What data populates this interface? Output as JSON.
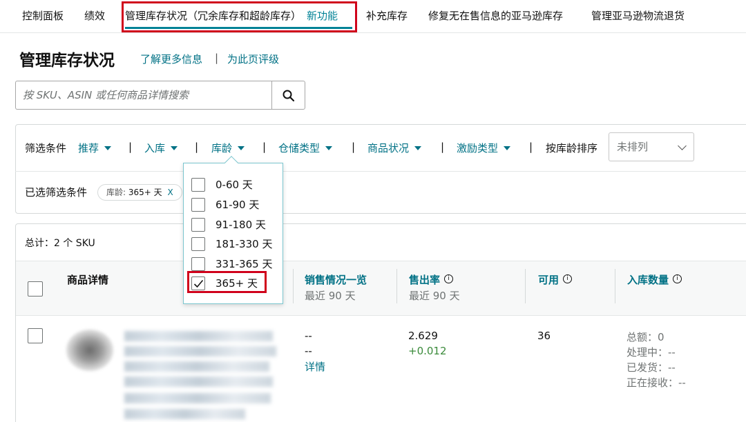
{
  "topnav": {
    "tabs": [
      "控制面板",
      "绩效",
      "管理库存状况（冗余库存和超龄库存）",
      "新功能",
      "补充库存",
      "修复无在售信息的亚马逊库存",
      "管理亚马逊物流退货"
    ]
  },
  "header": {
    "title": "管理库存状况",
    "learn_more": "了解更多信息",
    "separator": "|",
    "rate_page": "为此页评级"
  },
  "search": {
    "placeholder": "按 SKU、ASIN 或任何商品详情搜索"
  },
  "filters": {
    "label": "筛选条件",
    "items": [
      "推荐",
      "入库",
      "库龄",
      "仓储类型",
      "商品状况",
      "激励类型"
    ],
    "sort_label": "按库龄排序",
    "sort_value": "未排列",
    "selected_label": "已选筛选条件",
    "chip_key": "库龄:",
    "chip_value": "365+ 天",
    "chip_remove": "X"
  },
  "age_dropdown": {
    "options": [
      {
        "label": "0-60 天",
        "checked": false
      },
      {
        "label": "61-90 天",
        "checked": false
      },
      {
        "label": "91-180 天",
        "checked": false
      },
      {
        "label": "181-330 天",
        "checked": false
      },
      {
        "label": "331-365 天",
        "checked": false
      },
      {
        "label": "365+ 天",
        "checked": true
      }
    ]
  },
  "table": {
    "total": "总计：2 个 SKU",
    "columns": {
      "product": "商品详情",
      "sales": "销售情况一览",
      "sales_sub": "最近 90 天",
      "sell_through": "售出率",
      "sell_through_sub": "最近 90 天",
      "available": "可用",
      "inbound": "入库数量"
    },
    "rows": [
      {
        "sales_1": "--",
        "sales_2": "--",
        "details_link": "详情",
        "sell_through": "2.629",
        "sell_through_delta": "+0.012",
        "available": "36",
        "inbound_total": "总额：0",
        "inbound_processing": "处理中：--",
        "inbound_shipped": "已发货：--",
        "inbound_receiving": "正在接收：--"
      }
    ]
  },
  "colors": {
    "link": "#007185",
    "accent_teal": "#008296",
    "highlight_red": "#d0021b",
    "positive": "#3a8a3a"
  },
  "icons": {
    "search": "search-icon",
    "info": "info-icon",
    "caret": "caret-down-icon",
    "chevron": "chevron-down-icon",
    "check": "checkmark-icon"
  }
}
